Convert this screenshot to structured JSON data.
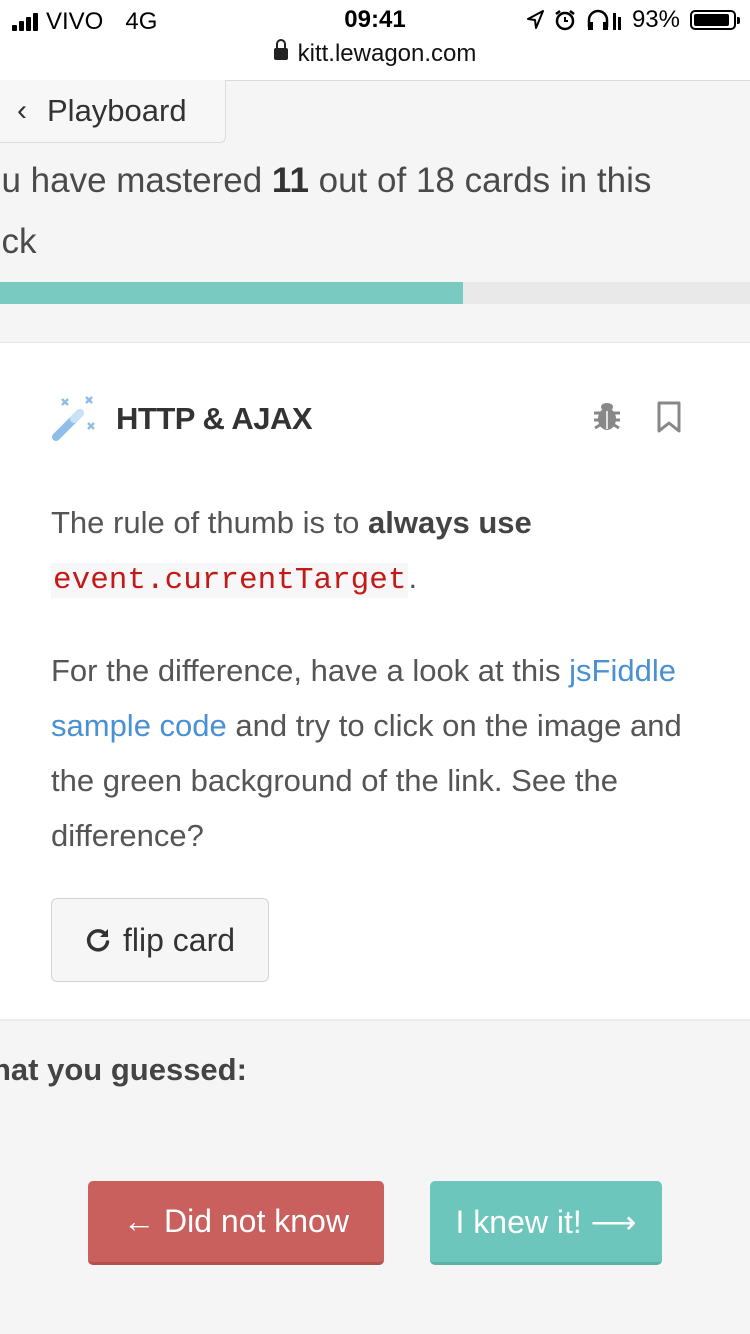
{
  "status_bar": {
    "carrier": "VIVO",
    "network": "4G",
    "time": "09:41",
    "battery": "93%",
    "url": "kitt.lewagon.com"
  },
  "nav": {
    "back_label": "Playboard"
  },
  "progress": {
    "prefix": "ou have mastered ",
    "mastered_count": "11",
    "middle": " out of ",
    "total": "18",
    "suffix": " cards in this",
    "line2": "eck",
    "fraction": 0.617,
    "color": "#79cbc1"
  },
  "card": {
    "title": "HTTP & AJAX",
    "p1_a": "The rule of thumb is to ",
    "p1_bold": "always use",
    "p1_code": "event.currentTarget",
    "p1_end": ".",
    "p2_a": "For the difference, have a look at this ",
    "p2_link": "jsFiddle sample code",
    "p2_b": " and try to click on the image and the green background of the link. See the difference?",
    "flip_label": "flip card"
  },
  "guess": {
    "heading": "hat you guessed:",
    "no_label": "← Did not know",
    "yes_label": "I knew it! ⟶",
    "no_color": "#c9605d",
    "yes_color": "#6cc6bb"
  }
}
